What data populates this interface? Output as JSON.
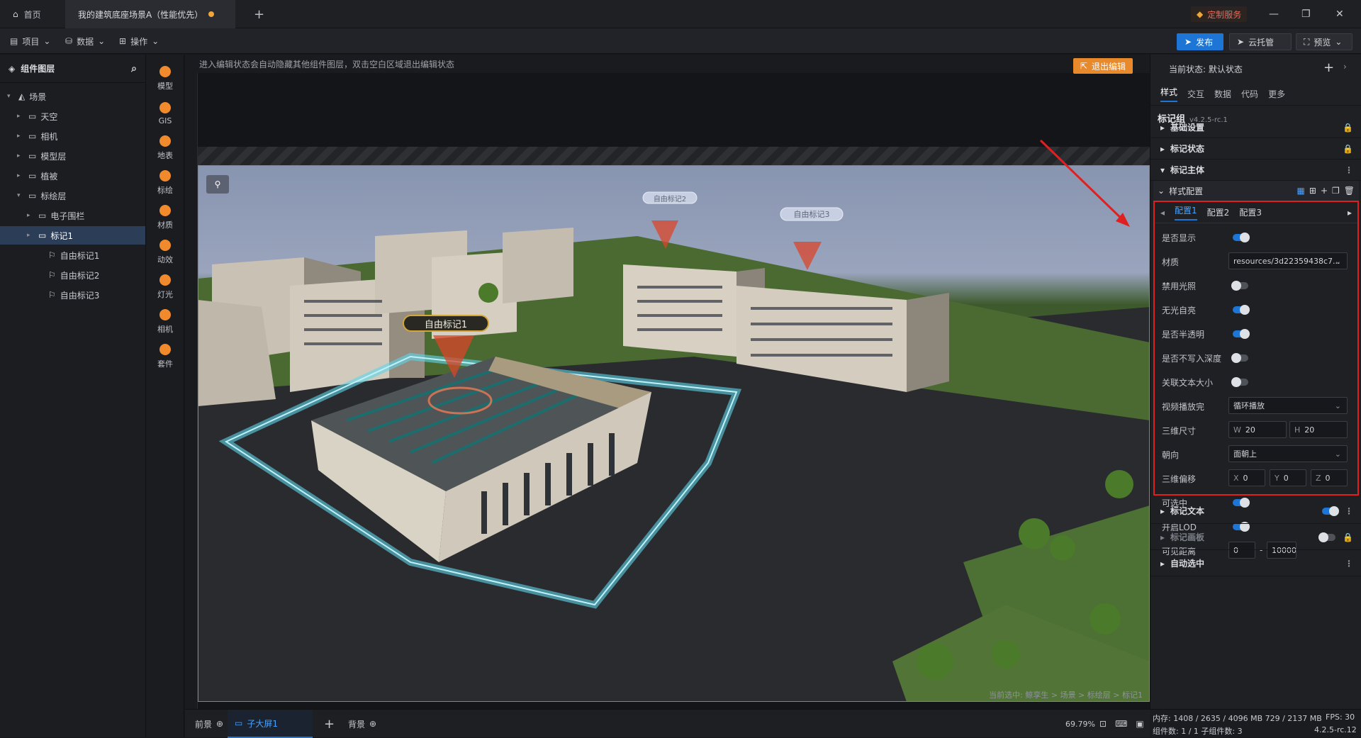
{
  "window": {
    "home_tab": "首页",
    "doc_tab": "我的建筑底座场景A（性能优先）",
    "custom_service": "定制服务"
  },
  "menubar": {
    "project": "项目",
    "data": "数据",
    "operate": "操作",
    "publish": "发布",
    "cloud": "云托管",
    "preview": "预览"
  },
  "layers": {
    "title": "组件图层",
    "items": [
      {
        "label": "场景",
        "depth": 0,
        "expanded": true
      },
      {
        "label": "天空",
        "depth": 1
      },
      {
        "label": "相机",
        "depth": 1
      },
      {
        "label": "模型层",
        "depth": 1
      },
      {
        "label": "植被",
        "depth": 1
      },
      {
        "label": "标绘层",
        "depth": 1,
        "expanded": true
      },
      {
        "label": "电子围栏",
        "depth": 2
      },
      {
        "label": "标记1",
        "depth": 2,
        "selected": true
      },
      {
        "label": "自由标记1",
        "depth": 3
      },
      {
        "label": "自由标记2",
        "depth": 3
      },
      {
        "label": "自由标记3",
        "depth": 3
      }
    ]
  },
  "toolbox": [
    "模型",
    "GIS",
    "地表",
    "标绘",
    "材质",
    "动效",
    "灯光",
    "相机",
    "套件"
  ],
  "canvas": {
    "hint": "进入编辑状态会自动隐藏其他组件图层，双击空白区域退出编辑状态",
    "exit_edit": "退出编辑",
    "marker1": "自由标记1",
    "marker2": "自由标记2",
    "marker3": "自由标记3",
    "breadcrumb": "当前选中: 鲸孪生 > 场景 > 标绘层 > 标记1"
  },
  "bottombar": {
    "foreground": "前景",
    "subscreen": "子大屏1",
    "background": "背景",
    "zoom": "69.79%"
  },
  "right": {
    "state": "当前状态: 默认状态",
    "tabs": [
      "样式",
      "交互",
      "数据",
      "代码",
      "更多"
    ],
    "component": "标记组",
    "version": "v4.2.5-rc.1",
    "sections": [
      "基础设置",
      "标记状态",
      "标记主体"
    ],
    "style_config": "样式配置",
    "configs": [
      "配置1",
      "配置2",
      "配置3"
    ],
    "props": {
      "show": "是否显示",
      "material": "材质",
      "material_value": "resources/3d22359438c7...",
      "no_light": "禁用光照",
      "self_lit": "无光自亮",
      "translucent": "是否半透明",
      "no_depth": "是否不写入深度",
      "text_size": "关联文本大小",
      "video": "视频播放完",
      "video_value": "循环播放",
      "size3d": "三维尺寸",
      "w": "20",
      "h": "20",
      "facing": "朝向",
      "facing_value": "面朝上",
      "offset": "三维偏移",
      "x": "0",
      "y": "0",
      "z": "0",
      "selectable": "可选中",
      "lod": "开启LOD",
      "distance": "可见距离",
      "dist_min": "0",
      "dist_max": "10000"
    },
    "bottom_sections": [
      "标记文本",
      "标记画板",
      "自动选中"
    ]
  },
  "status": {
    "memory": "内存: 1408 / 2635 / 4096 MB  729 / 2137 MB",
    "fps": "FPS: 30",
    "count": "组件数: 1 / 1   子组件数: 3",
    "version": "4.2.5-rc.12"
  },
  "colors": {
    "accent": "#1d76d6",
    "warning": "#e8892b",
    "highlight": "#e02020"
  }
}
